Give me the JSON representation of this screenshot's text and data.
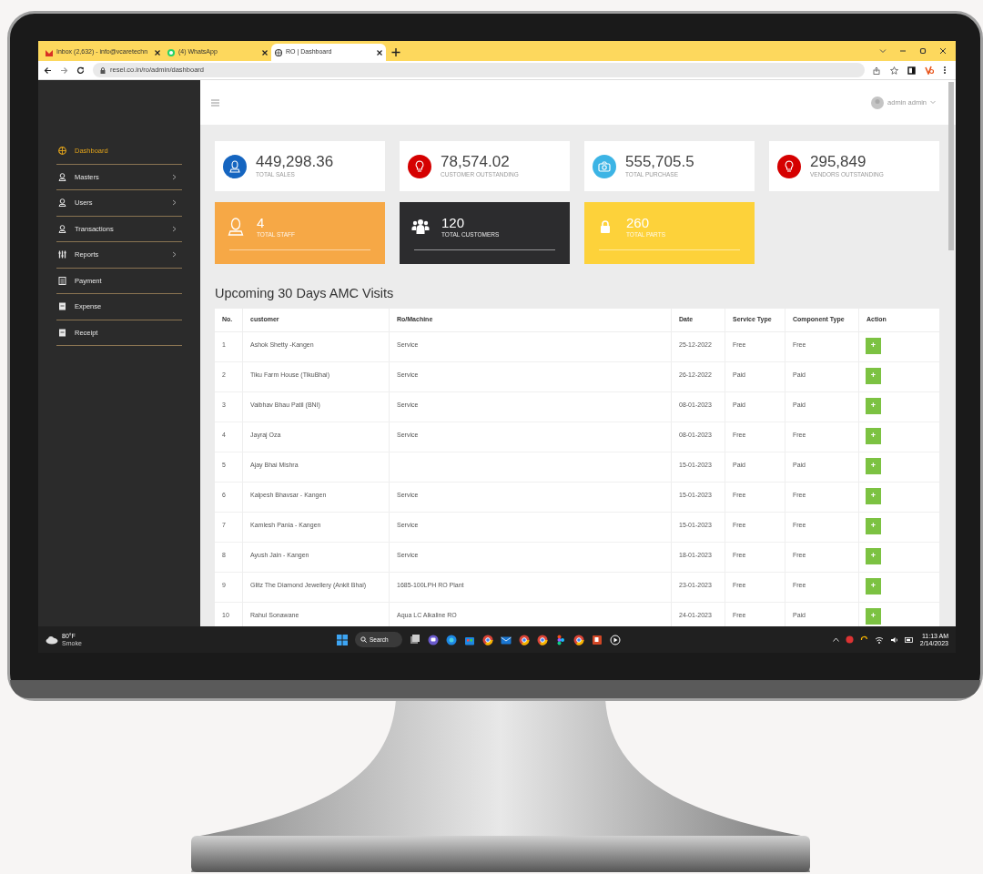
{
  "browser": {
    "tabs": [
      {
        "title": "Inbox (2,632) - info@vcaretechn",
        "selected": false
      },
      {
        "title": "(4) WhatsApp",
        "selected": false
      },
      {
        "title": "RO | Dashboard",
        "selected": true
      }
    ],
    "address": "resel.co.in/ro/admin/dashboard"
  },
  "header": {
    "user": "admin admin"
  },
  "sidebar": {
    "items": [
      {
        "label": "Dashboard",
        "selected": true,
        "submenu": false
      },
      {
        "label": "Masters",
        "selected": false,
        "submenu": true
      },
      {
        "label": "Users",
        "selected": false,
        "submenu": true
      },
      {
        "label": "Transactions",
        "selected": false,
        "submenu": true
      },
      {
        "label": "Reports",
        "selected": false,
        "submenu": true
      },
      {
        "label": "Payment",
        "selected": false,
        "submenu": false
      },
      {
        "label": "Expense",
        "selected": false,
        "submenu": false
      },
      {
        "label": "Receipt",
        "selected": false,
        "submenu": false
      }
    ]
  },
  "stats": [
    {
      "value": "449,298.36",
      "label": "TOTAL SALES",
      "kind": "outlined",
      "color": "#1565c0"
    },
    {
      "value": "78,574.02",
      "label": "CUSTOMER OUTSTANDING",
      "kind": "outlined",
      "color": "#d50000"
    },
    {
      "value": "555,705.5",
      "label": "TOTAL PURCHASE",
      "kind": "outlined",
      "color": "#3cb4e5"
    },
    {
      "value": "295,849",
      "label": "VENDORS OUTSTANDING",
      "kind": "outlined",
      "color": "#d50000"
    },
    {
      "value": "4",
      "label": "TOTAL STAFF",
      "kind": "filled",
      "color": "#f6a846"
    },
    {
      "value": "120",
      "label": "TOTAL CUSTOMERS",
      "kind": "filled",
      "color": "#2c2c2e"
    },
    {
      "value": "260",
      "label": "TOTAL PARTS",
      "kind": "filled",
      "color": "#fdd23a"
    }
  ],
  "table": {
    "title": "Upcoming 30 Days AMC Visits",
    "columns": [
      "No.",
      "customer",
      "Ro/Machine",
      "Date",
      "Service Type",
      "Component Type",
      "Action"
    ],
    "rows": [
      {
        "no": "1",
        "customer": "Ashok Shetty -Kangen",
        "machine": "Service",
        "date": "25-12-2022",
        "service_type": "Free",
        "component_type": "Free",
        "action": "+"
      },
      {
        "no": "2",
        "customer": "Tiku Farm House (TikuBhai)",
        "machine": "Service",
        "date": "26-12-2022",
        "service_type": "Paid",
        "component_type": "Paid",
        "action": "+"
      },
      {
        "no": "3",
        "customer": "Vaibhav Bhau Patil (BNI)",
        "machine": "Service",
        "date": "08-01-2023",
        "service_type": "Paid",
        "component_type": "Paid",
        "action": "+"
      },
      {
        "no": "4",
        "customer": "Jayraj Oza",
        "machine": "Service",
        "date": "08-01-2023",
        "service_type": "Free",
        "component_type": "Free",
        "action": "+"
      },
      {
        "no": "5",
        "customer": "Ajay Bhai Mishra",
        "date": "15-01-2023",
        "service_type": "Paid",
        "component_type": "Paid",
        "action": "+"
      },
      {
        "no": "6",
        "customer": "Kalpesh Bhavsar - Kangen",
        "machine": "Service",
        "date": "15-01-2023",
        "service_type": "Free",
        "component_type": "Free",
        "action": "+"
      },
      {
        "no": "7",
        "customer": "Kamlesh Pania - Kangen",
        "machine": "Service",
        "date": "15-01-2023",
        "service_type": "Free",
        "component_type": "Free",
        "action": "+"
      },
      {
        "no": "8",
        "customer": "Ayush Jain - Kangen",
        "machine": "Service",
        "date": "18-01-2023",
        "service_type": "Free",
        "component_type": "Free",
        "action": "+"
      },
      {
        "no": "9",
        "customer": "Glitz The Diamond Jewellery (Ankit Bhai)",
        "machine": "1685-100LPH RO Plant",
        "date": "23-01-2023",
        "service_type": "Free",
        "component_type": "Free",
        "action": "+"
      },
      {
        "no": "10",
        "customer": "Rahul Sonawane",
        "machine": "Aqua LC Alkaline RO",
        "date": "24-01-2023",
        "service_type": "Free",
        "component_type": "Paid",
        "action": "+"
      }
    ]
  },
  "taskbar": {
    "weather_temp": "80°F",
    "weather_text": "Smoke",
    "search": "Search",
    "time": "11:13 AM",
    "date": "2/14/2023"
  }
}
